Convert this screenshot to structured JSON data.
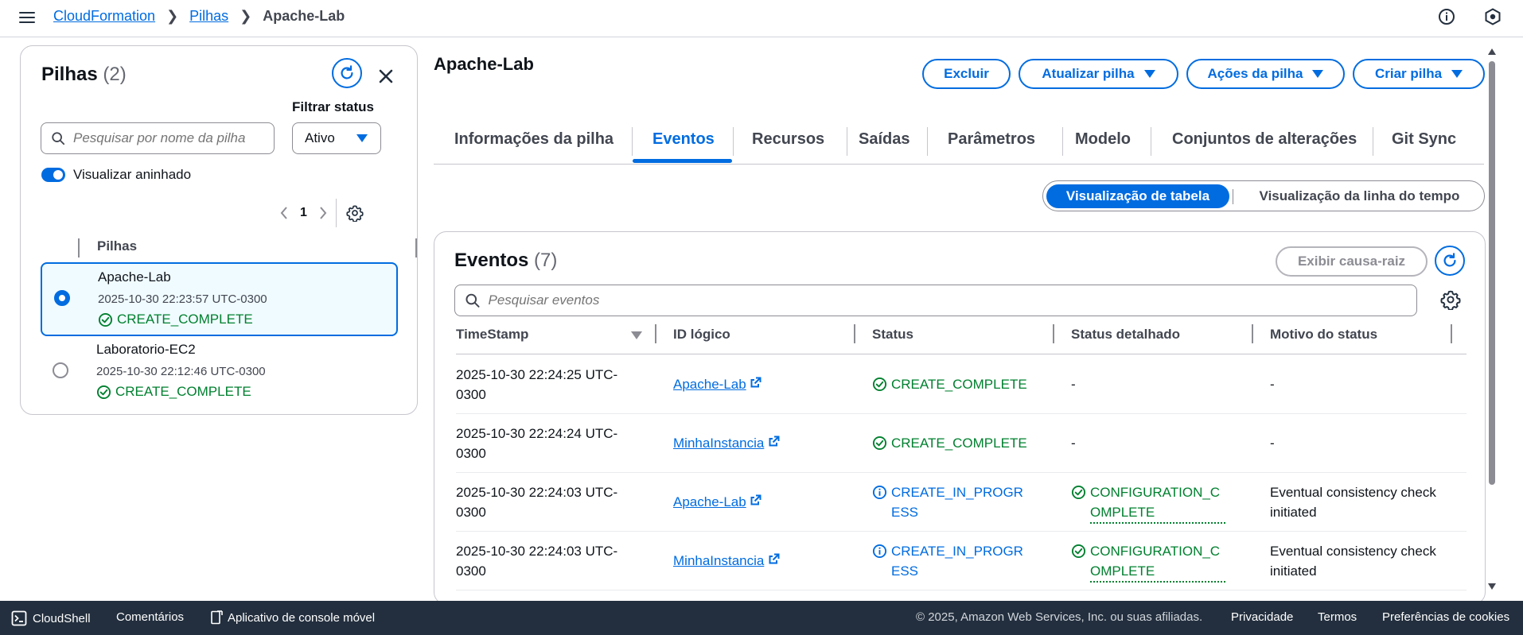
{
  "breadcrumb": {
    "items": [
      "CloudFormation",
      "Pilhas"
    ],
    "current": "Apache-Lab"
  },
  "left_panel": {
    "title": "Pilhas",
    "count": "(2)",
    "filter_label": "Filtrar status",
    "search_placeholder": "Pesquisar por nome da pilha",
    "filter_value": "Ativo",
    "toggle_label": "Visualizar aninhado",
    "page": "1",
    "column_header": "Pilhas",
    "stacks": [
      {
        "name": "Apache-Lab",
        "date": "2025-10-30 22:23:57 UTC-0300",
        "status": "CREATE_COMPLETE",
        "selected": true
      },
      {
        "name": "Laboratorio-EC2",
        "date": "2025-10-30 22:12:46 UTC-0300",
        "status": "CREATE_COMPLETE",
        "selected": false
      }
    ]
  },
  "main": {
    "title": "Apache-Lab",
    "buttons": {
      "delete": "Excluir",
      "update": "Atualizar pilha",
      "actions": "Ações da pilha",
      "create": "Criar pilha"
    },
    "tabs": [
      "Informações da pilha",
      "Eventos",
      "Recursos",
      "Saídas",
      "Parâmetros",
      "Modelo",
      "Conjuntos de alterações",
      "Git Sync"
    ],
    "active_tab": "Eventos",
    "view_toggle": {
      "table": "Visualização de tabela",
      "timeline": "Visualização da linha do tempo"
    }
  },
  "events": {
    "title": "Eventos",
    "count": "(7)",
    "root_cause_button": "Exibir causa-raiz",
    "search_placeholder": "Pesquisar eventos",
    "columns": [
      "TimeStamp",
      "ID lógico",
      "Status",
      "Status detalhado",
      "Motivo do status"
    ],
    "rows": [
      {
        "timestamp": "2025-10-30 22:24:25 UTC-0300",
        "logical_id": "Apache-Lab",
        "status": "CREATE_COMPLETE",
        "status_type": "ok",
        "detailed": "-",
        "reason": "-"
      },
      {
        "timestamp": "2025-10-30 22:24:24 UTC-0300",
        "logical_id": "MinhaInstancia",
        "status": "CREATE_COMPLETE",
        "status_type": "ok",
        "detailed": "-",
        "reason": "-"
      },
      {
        "timestamp": "2025-10-30 22:24:03 UTC-0300",
        "logical_id": "Apache-Lab",
        "status": "CREATE_IN_PROGRESS",
        "status_type": "info",
        "detailed": "CONFIGURATION_COMPLETE",
        "reason": "Eventual consistency check initiated"
      },
      {
        "timestamp": "2025-10-30 22:24:03 UTC-0300",
        "logical_id": "MinhaInstancia",
        "status": "CREATE_IN_PROGRESS",
        "status_type": "info",
        "detailed": "CONFIGURATION_COMPLETE",
        "reason": "Eventual consistency check initiated"
      }
    ]
  },
  "footer": {
    "cloudshell": "CloudShell",
    "feedback": "Comentários",
    "mobile_app": "Aplicativo de console móvel",
    "copyright": "© 2025, Amazon Web Services, Inc. ou suas afiliadas.",
    "privacy": "Privacidade",
    "terms": "Termos",
    "cookies": "Preferências de cookies"
  },
  "colors": {
    "accent": "#006ce0",
    "success": "#00802f",
    "footer_bg": "#232f3e"
  },
  "icons": [
    "hamburger-icon",
    "info-icon",
    "settings-hex-icon",
    "refresh-icon",
    "close-icon",
    "search-icon",
    "chevron-left-icon",
    "chevron-right-icon",
    "gear-icon",
    "check-circle-icon",
    "info-circle-icon",
    "external-link-icon",
    "cloudshell-icon",
    "mobile-app-icon"
  ]
}
